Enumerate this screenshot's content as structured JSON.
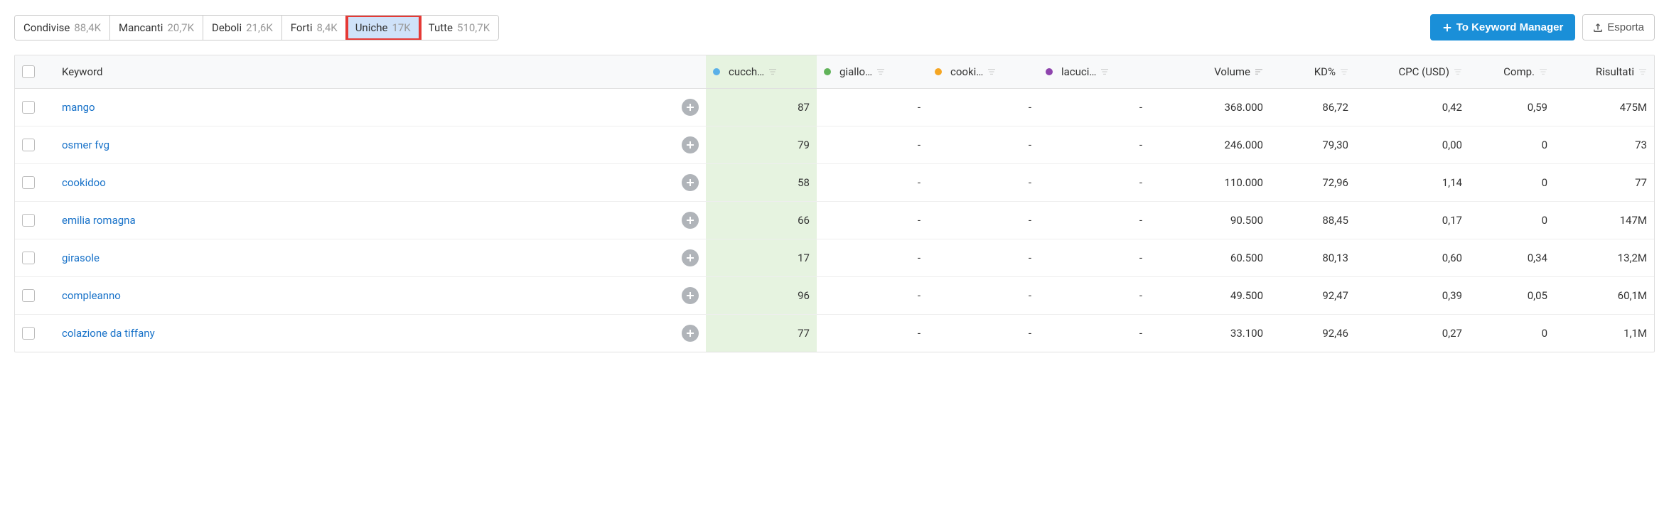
{
  "tabs": [
    {
      "label": "Condivise",
      "count": "88,4K",
      "active": false
    },
    {
      "label": "Mancanti",
      "count": "20,7K",
      "active": false
    },
    {
      "label": "Deboli",
      "count": "21,6K",
      "active": false
    },
    {
      "label": "Forti",
      "count": "8,4K",
      "active": false
    },
    {
      "label": "Uniche",
      "count": "17K",
      "active": true
    },
    {
      "label": "Tutte",
      "count": "510,7K",
      "active": false
    }
  ],
  "actions": {
    "primary": "To Keyword Manager",
    "export": "Esporta"
  },
  "columns": {
    "keyword": "Keyword",
    "comp1": "cucch…",
    "comp2": "giallo…",
    "comp3": "cooki…",
    "comp4": "lacuci…",
    "volume": "Volume",
    "kd": "KD%",
    "cpc": "CPC (USD)",
    "comp": "Comp.",
    "results": "Risultati"
  },
  "rows": [
    {
      "keyword": "mango",
      "c1": "87",
      "c2": "-",
      "c3": "-",
      "c4": "-",
      "volume": "368.000",
      "kd": "86,72",
      "cpc": "0,42",
      "comp": "0,59",
      "results": "475M"
    },
    {
      "keyword": "osmer fvg",
      "c1": "79",
      "c2": "-",
      "c3": "-",
      "c4": "-",
      "volume": "246.000",
      "kd": "79,30",
      "cpc": "0,00",
      "comp": "0",
      "results": "73"
    },
    {
      "keyword": "cookidoo",
      "c1": "58",
      "c2": "-",
      "c3": "-",
      "c4": "-",
      "volume": "110.000",
      "kd": "72,96",
      "cpc": "1,14",
      "comp": "0",
      "results": "77"
    },
    {
      "keyword": "emilia romagna",
      "c1": "66",
      "c2": "-",
      "c3": "-",
      "c4": "-",
      "volume": "90.500",
      "kd": "88,45",
      "cpc": "0,17",
      "comp": "0",
      "results": "147M"
    },
    {
      "keyword": "girasole",
      "c1": "17",
      "c2": "-",
      "c3": "-",
      "c4": "-",
      "volume": "60.500",
      "kd": "80,13",
      "cpc": "0,60",
      "comp": "0,34",
      "results": "13,2M"
    },
    {
      "keyword": "compleanno",
      "c1": "96",
      "c2": "-",
      "c3": "-",
      "c4": "-",
      "volume": "49.500",
      "kd": "92,47",
      "cpc": "0,39",
      "comp": "0,05",
      "results": "60,1M"
    },
    {
      "keyword": "colazione da tiffany",
      "c1": "77",
      "c2": "-",
      "c3": "-",
      "c4": "-",
      "volume": "33.100",
      "kd": "92,46",
      "cpc": "0,27",
      "comp": "0",
      "results": "1,1M"
    }
  ]
}
